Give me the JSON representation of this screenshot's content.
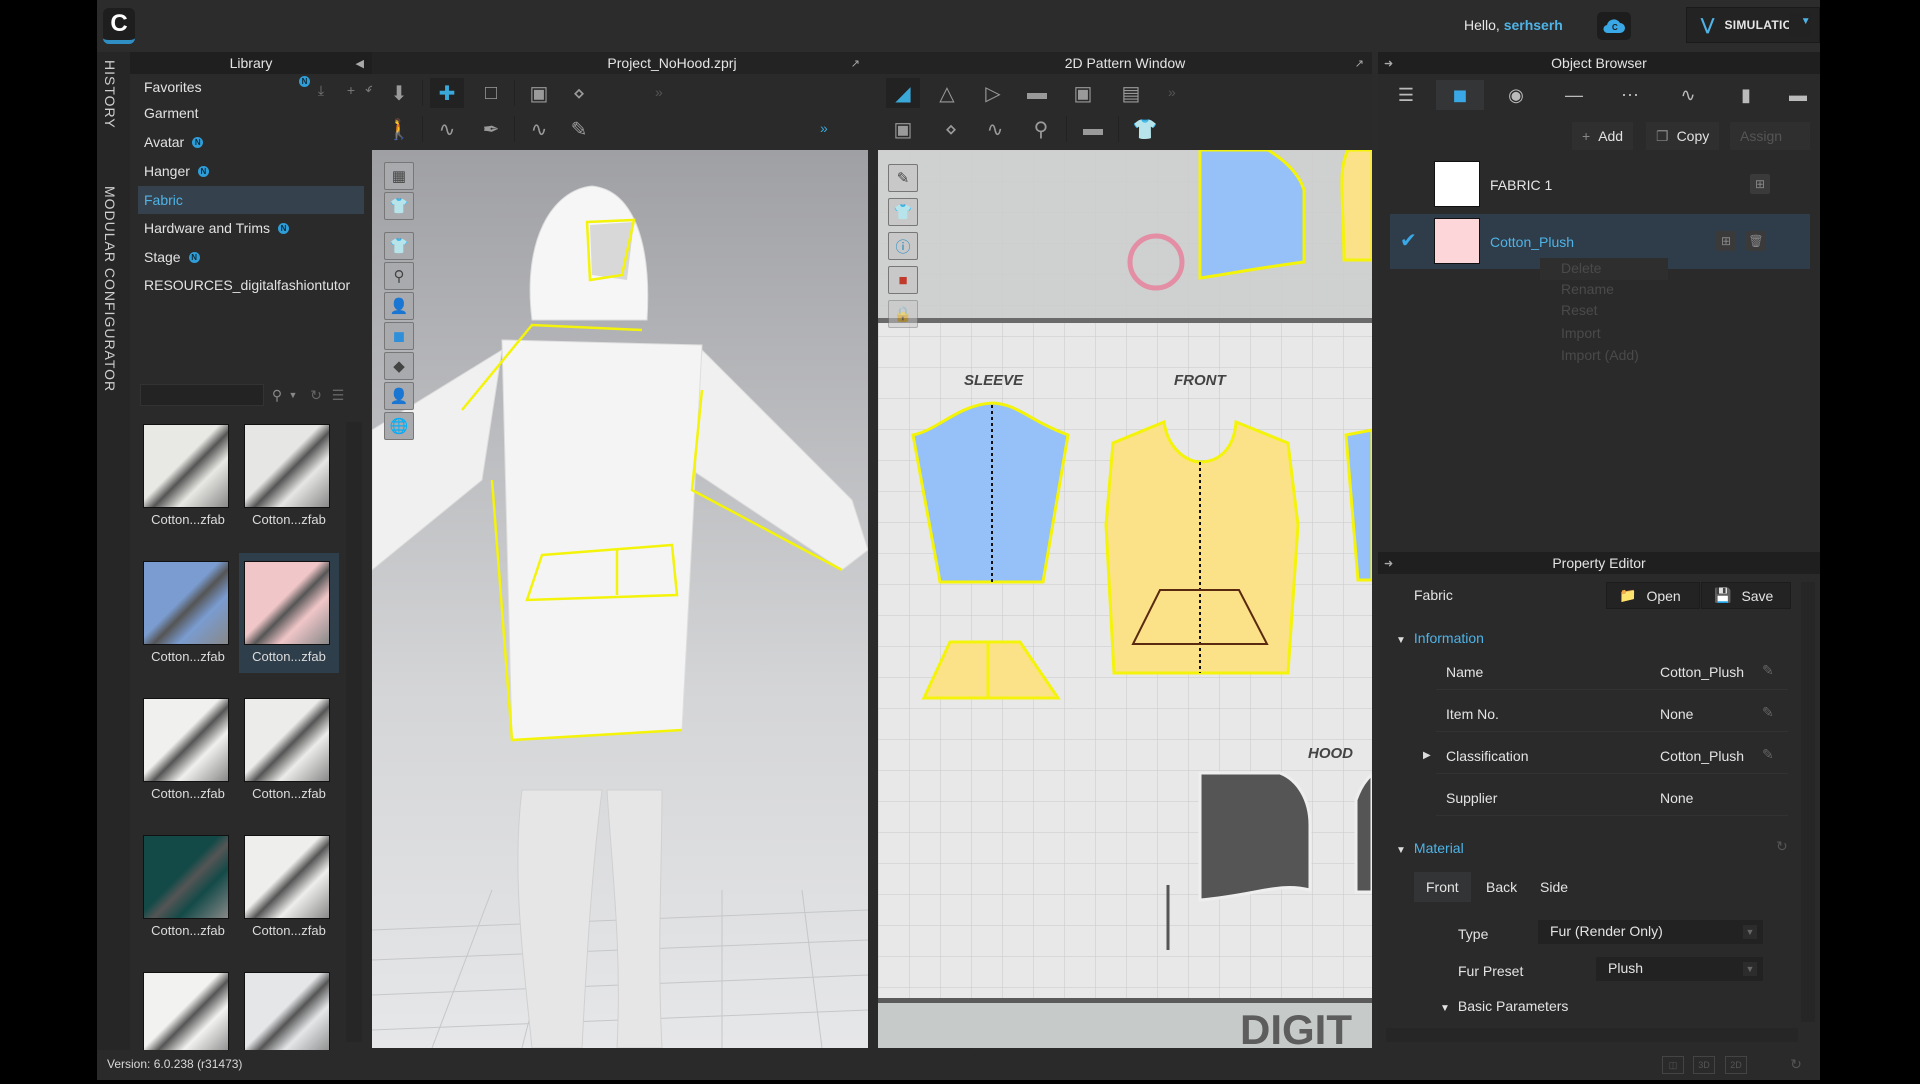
{
  "topbar": {
    "logo": "C",
    "greeting": "Hello, ",
    "username": "serhserh",
    "cloud_icon": "cloud-icon",
    "mode_button": "SIMULATION"
  },
  "side_tabs": [
    "HISTORY",
    "MODULAR CONFIGURATOR"
  ],
  "library": {
    "title": "Library",
    "items": [
      {
        "label": "Favorites",
        "badge": true
      },
      {
        "label": "Garment",
        "badge": false
      },
      {
        "label": "Avatar",
        "badge": true
      },
      {
        "label": "Hanger",
        "badge": true
      },
      {
        "label": "Fabric",
        "badge": false,
        "selected": true
      },
      {
        "label": "Hardware and Trims",
        "badge": true
      },
      {
        "label": "Stage",
        "badge": true
      },
      {
        "label": "RESOURCES_digitalfashiontutor",
        "badge": false
      }
    ],
    "search_value": "",
    "thumbnails": [
      {
        "label": "Cotton...zfab",
        "color": "#e8e8e4"
      },
      {
        "label": "Cotton...zfab",
        "color": "#e6e6e4"
      },
      {
        "label": "Cotton...zfab",
        "color": "#7a9cd0"
      },
      {
        "label": "Cotton...zfab",
        "color": "#f0c6c8",
        "selected": true
      },
      {
        "label": "Cotton...zfab",
        "color": "#f0f0ee"
      },
      {
        "label": "Cotton...zfab",
        "color": "#ececea"
      },
      {
        "label": "Cotton...zfab",
        "color": "#134a48"
      },
      {
        "label": "Cotton...zfab",
        "color": "#eeeeec"
      },
      {
        "label": "Cotton...zfab",
        "color": "#f2f2f0"
      },
      {
        "label": "Cotton...zfab",
        "color": "#e4e6e8"
      }
    ]
  },
  "viewport3d": {
    "title": "Project_NoHood.zprj"
  },
  "pattern2d": {
    "title": "2D Pattern Window",
    "labels": {
      "sleeve": "SLEEVE",
      "front": "FRONT",
      "hood": "HOOD",
      "footer": "DIGIT"
    }
  },
  "object_browser": {
    "title": "Object Browser",
    "add_label": "Add",
    "copy_label": "Copy",
    "assign_label": "Assign",
    "fabrics": [
      {
        "name": "FABRIC 1",
        "color": "#ffffff"
      },
      {
        "name": "Cotton_Plush",
        "color": "#fcd6d8",
        "selected": true
      }
    ],
    "context_menu": [
      "Delete",
      "Rename",
      "Reset",
      "Import",
      "Import (Add)"
    ]
  },
  "property_editor": {
    "title": "Property Editor",
    "object_label": "Fabric",
    "open_label": "Open",
    "save_label": "Save",
    "information": {
      "title": "Information",
      "rows": [
        {
          "label": "Name",
          "value": "Cotton_Plush",
          "editable": true
        },
        {
          "label": "Item No.",
          "value": "None",
          "editable": true
        },
        {
          "label": "Classification",
          "value": "Cotton_Plush",
          "editable": true,
          "expandable": true
        },
        {
          "label": "Supplier",
          "value": "None",
          "editable": false
        }
      ]
    },
    "material": {
      "title": "Material",
      "tabs": [
        "Front",
        "Back",
        "Side"
      ],
      "active_tab": "Front",
      "type_label": "Type",
      "type_value": "Fur (Render Only)",
      "preset_label": "Fur Preset",
      "preset_value": "Plush",
      "basic_params": "Basic Parameters"
    }
  },
  "status": {
    "version": "Version: 6.0.238 (r31473)",
    "view_buttons": [
      "3D",
      "2D"
    ]
  }
}
